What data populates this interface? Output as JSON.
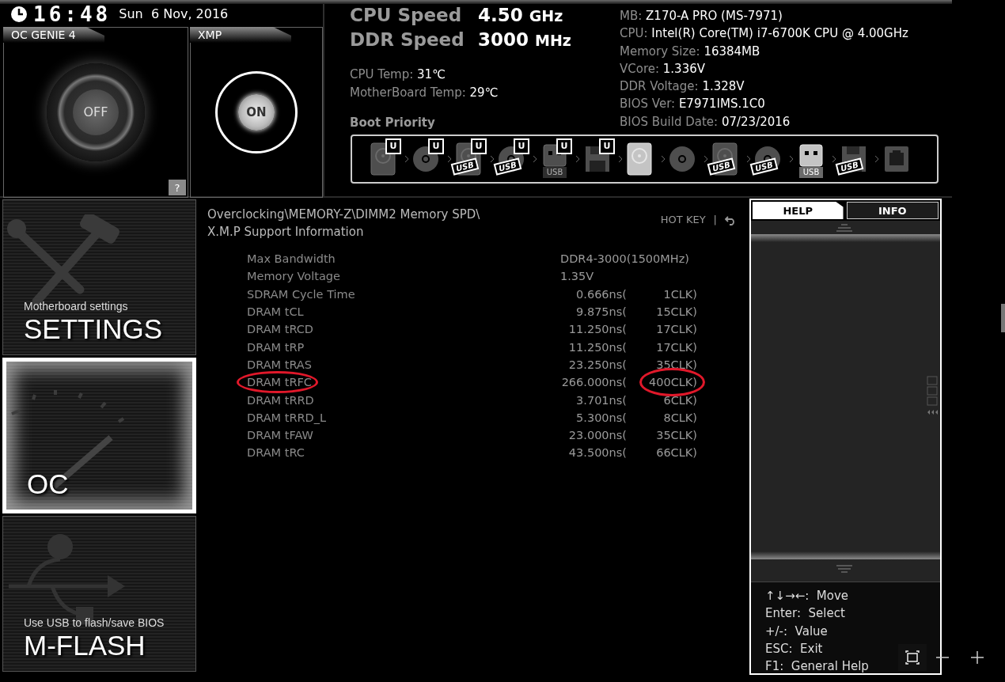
{
  "clock": {
    "time": "16:48",
    "date": "Sun  6 Nov, 2016"
  },
  "oc_genie": {
    "title": "OC GENIE 4",
    "state": "OFF",
    "on": false,
    "help": "?"
  },
  "xmp": {
    "title": "XMP",
    "state": "ON",
    "on": true
  },
  "speeds": [
    {
      "label": "CPU Speed",
      "value": "4.50",
      "unit": "GHz"
    },
    {
      "label": "DDR Speed",
      "value": "3000",
      "unit": "MHz"
    }
  ],
  "temps": [
    {
      "label": "CPU Temp:",
      "value": "31℃"
    },
    {
      "label": "MotherBoard Temp:",
      "value": "29℃"
    }
  ],
  "system_info": [
    {
      "label": "MB:",
      "value": "Z170-A PRO (MS-7971)"
    },
    {
      "label": "CPU:",
      "value": "Intel(R) Core(TM) i7-6700K CPU @ 4.00GHz"
    },
    {
      "label": "Memory Size:",
      "value": "16384MB"
    },
    {
      "label": "VCore:",
      "value": "1.336V"
    },
    {
      "label": "DDR Voltage:",
      "value": "1.328V"
    },
    {
      "label": "BIOS Ver:",
      "value": "E7971IMS.1C0"
    },
    {
      "label": "BIOS Build Date:",
      "value": "07/23/2016"
    }
  ],
  "boot_priority": {
    "title": "Boot Priority",
    "devices": [
      {
        "kind": "hdd",
        "badge": "U",
        "bright": false
      },
      {
        "kind": "optical",
        "badge": "U",
        "bright": false
      },
      {
        "kind": "hdd",
        "badge": "U",
        "tag": "USB",
        "bright": false
      },
      {
        "kind": "optical",
        "badge": "U",
        "tag": "USB",
        "bright": false
      },
      {
        "kind": "usb-key",
        "badge": "U",
        "tag": "USB",
        "bright": false
      },
      {
        "kind": "floppy",
        "badge": "U",
        "bright": false
      },
      {
        "kind": "hdd",
        "bright": true
      },
      {
        "kind": "optical",
        "bright": false
      },
      {
        "kind": "hdd",
        "tag": "USB",
        "bright": false
      },
      {
        "kind": "optical",
        "tag": "USB",
        "bright": false
      },
      {
        "kind": "usb-key",
        "tag": "USB",
        "bright": true
      },
      {
        "kind": "floppy",
        "tag": "USB",
        "bright": false
      },
      {
        "kind": "network",
        "bright": false
      }
    ]
  },
  "sidebar": {
    "items": [
      {
        "subtitle": "Motherboard settings",
        "title": "SETTINGS",
        "selected": false
      },
      {
        "title": "OC",
        "selected": true
      },
      {
        "subtitle": "Use USB to flash/save BIOS",
        "title": "M-FLASH",
        "selected": false
      }
    ]
  },
  "breadcrumb": {
    "path": "Overclocking\\MEMORY-Z\\DIMM2 Memory SPD\\",
    "page": "X.M.P Support Information"
  },
  "hotkey": {
    "label": "HOT KEY",
    "separator": "|"
  },
  "rows": [
    {
      "name": "Max Bandwidth",
      "value": "DDR4-3000(1500MHz)",
      "circled": false
    },
    {
      "name": "Memory Voltage",
      "value": "1.35V",
      "circled": false
    },
    {
      "name": "SDRAM Cycle Time",
      "value": "0.666ns(",
      "clk": "1CLK)",
      "circled": false
    },
    {
      "name": "DRAM tCL",
      "value": "9.875ns(",
      "clk": "15CLK)",
      "circled": false
    },
    {
      "name": "DRAM tRCD",
      "value": "11.250ns(",
      "clk": "17CLK)",
      "circled": false
    },
    {
      "name": "DRAM tRP",
      "value": "11.250ns(",
      "clk": "17CLK)",
      "circled": false
    },
    {
      "name": "DRAM tRAS",
      "value": "23.250ns(",
      "clk": "35CLK)",
      "circled": false
    },
    {
      "name": "DRAM tRFC",
      "value": "266.000ns(",
      "clk": "400CLK)",
      "circled": true
    },
    {
      "name": "DRAM tRRD",
      "value": "3.701ns(",
      "clk": "6CLK)",
      "circled": false
    },
    {
      "name": "DRAM tRRD_L",
      "value": "5.300ns(",
      "clk": "8CLK)",
      "circled": false
    },
    {
      "name": "DRAM tFAW",
      "value": "23.000ns(",
      "clk": "35CLK)",
      "circled": false
    },
    {
      "name": "DRAM tRC",
      "value": "43.500ns(",
      "clk": "66CLK)",
      "circled": false
    }
  ],
  "help_panel": {
    "tabs": [
      {
        "label": "HELP",
        "selected": true
      },
      {
        "label": "INFO",
        "selected": false
      }
    ],
    "keys": [
      {
        "key": "↑↓→←:",
        "action": "Move"
      },
      {
        "key": "Enter:",
        "action": "Select"
      },
      {
        "key": "+/-:",
        "action": "Value"
      },
      {
        "key": "ESC:",
        "action": "Exit"
      },
      {
        "key": "F1:",
        "action": "General Help"
      }
    ]
  }
}
